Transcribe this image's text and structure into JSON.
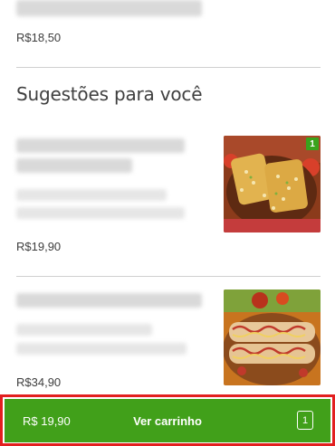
{
  "top_item": {
    "price": "R$18,50"
  },
  "suggestions": {
    "title": "Sugestões para você",
    "items": [
      {
        "price": "R$19,90",
        "image_icon": "loaded-fries-dish",
        "quantity_badge": "1"
      },
      {
        "price": "R$34,90",
        "image_icon": "hotdog-platter"
      }
    ]
  },
  "cart": {
    "total": "R$ 19,90",
    "label": "Ver carrinho",
    "count": "1"
  },
  "colors": {
    "accent": "#41a01a",
    "highlight": "#e21f1f"
  }
}
